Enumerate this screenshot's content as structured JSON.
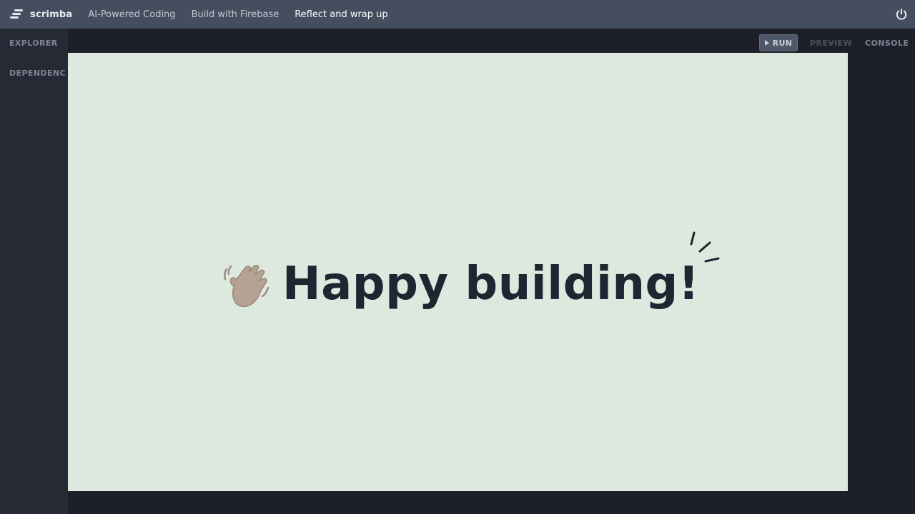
{
  "app": {
    "logo_text": "scrimba",
    "logo_icon": "scrimba-logo-icon"
  },
  "nav": {
    "links": [
      {
        "label": "AI-Powered Coding"
      },
      {
        "label": "Build with Firebase"
      },
      {
        "label": "Reflect and wrap up",
        "active": true
      }
    ],
    "power_icon": "power-icon"
  },
  "sidebar": {
    "explorer_label": "EXPLORER",
    "dependencies_label": "DEPENDENCIES"
  },
  "panel": {
    "run_label": "RUN",
    "preview_label": "PREVIEW",
    "console_label": "CONSOLE"
  },
  "slide": {
    "headline": "Happy building!",
    "emoji_icon": "waving-hand-icon",
    "sparkle_icon": "sparkle-lines-icon",
    "background": "#dde9de",
    "text_color": "#1f2531"
  },
  "colors": {
    "topbar": "#454e5f",
    "page_bg": "#1e2029",
    "sidebar_bg": "#262a35"
  }
}
